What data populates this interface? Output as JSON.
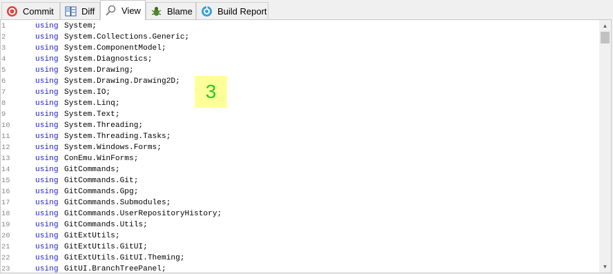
{
  "tabs": [
    {
      "label": "Commit",
      "icon": "commit-icon"
    },
    {
      "label": "Diff",
      "icon": "diff-icon"
    },
    {
      "label": "View",
      "icon": "view-search-icon",
      "active": true
    },
    {
      "label": "Blame",
      "icon": "blame-bug-icon"
    },
    {
      "label": "Build Report",
      "icon": "build-report-icon"
    }
  ],
  "code": {
    "keyword": "using",
    "lines": [
      {
        "num": "1",
        "ns": "System;"
      },
      {
        "num": "2",
        "ns": "System.Collections.Generic;"
      },
      {
        "num": "3",
        "ns": "System.ComponentModel;"
      },
      {
        "num": "4",
        "ns": "System.Diagnostics;"
      },
      {
        "num": "5",
        "ns": "System.Drawing;"
      },
      {
        "num": "6",
        "ns": "System.Drawing.Drawing2D;"
      },
      {
        "num": "7",
        "ns": "System.IO;"
      },
      {
        "num": "8",
        "ns": "System.Linq;"
      },
      {
        "num": "9",
        "ns": "System.Text;"
      },
      {
        "num": "10",
        "ns": "System.Threading;"
      },
      {
        "num": "11",
        "ns": "System.Threading.Tasks;"
      },
      {
        "num": "12",
        "ns": "System.Windows.Forms;"
      },
      {
        "num": "13",
        "ns": "ConEmu.WinForms;"
      },
      {
        "num": "14",
        "ns": "GitCommands;"
      },
      {
        "num": "15",
        "ns": "GitCommands.Git;"
      },
      {
        "num": "16",
        "ns": "GitCommands.Gpg;"
      },
      {
        "num": "17",
        "ns": "GitCommands.Submodules;"
      },
      {
        "num": "18",
        "ns": "GitCommands.UserRepositoryHistory;"
      },
      {
        "num": "19",
        "ns": "GitCommands.Utils;"
      },
      {
        "num": "20",
        "ns": "GitExtUtils;"
      },
      {
        "num": "21",
        "ns": "GitExtUtils.GitUI;"
      },
      {
        "num": "22",
        "ns": "GitExtUtils.GitUI.Theming;"
      },
      {
        "num": "23",
        "ns": "GitUI.BranchTreePanel;"
      }
    ]
  },
  "overlay_badge": "3",
  "colors": {
    "keyword": "#1c1ccc",
    "badge_bg": "#ffff99",
    "badge_text": "#22cc22"
  }
}
